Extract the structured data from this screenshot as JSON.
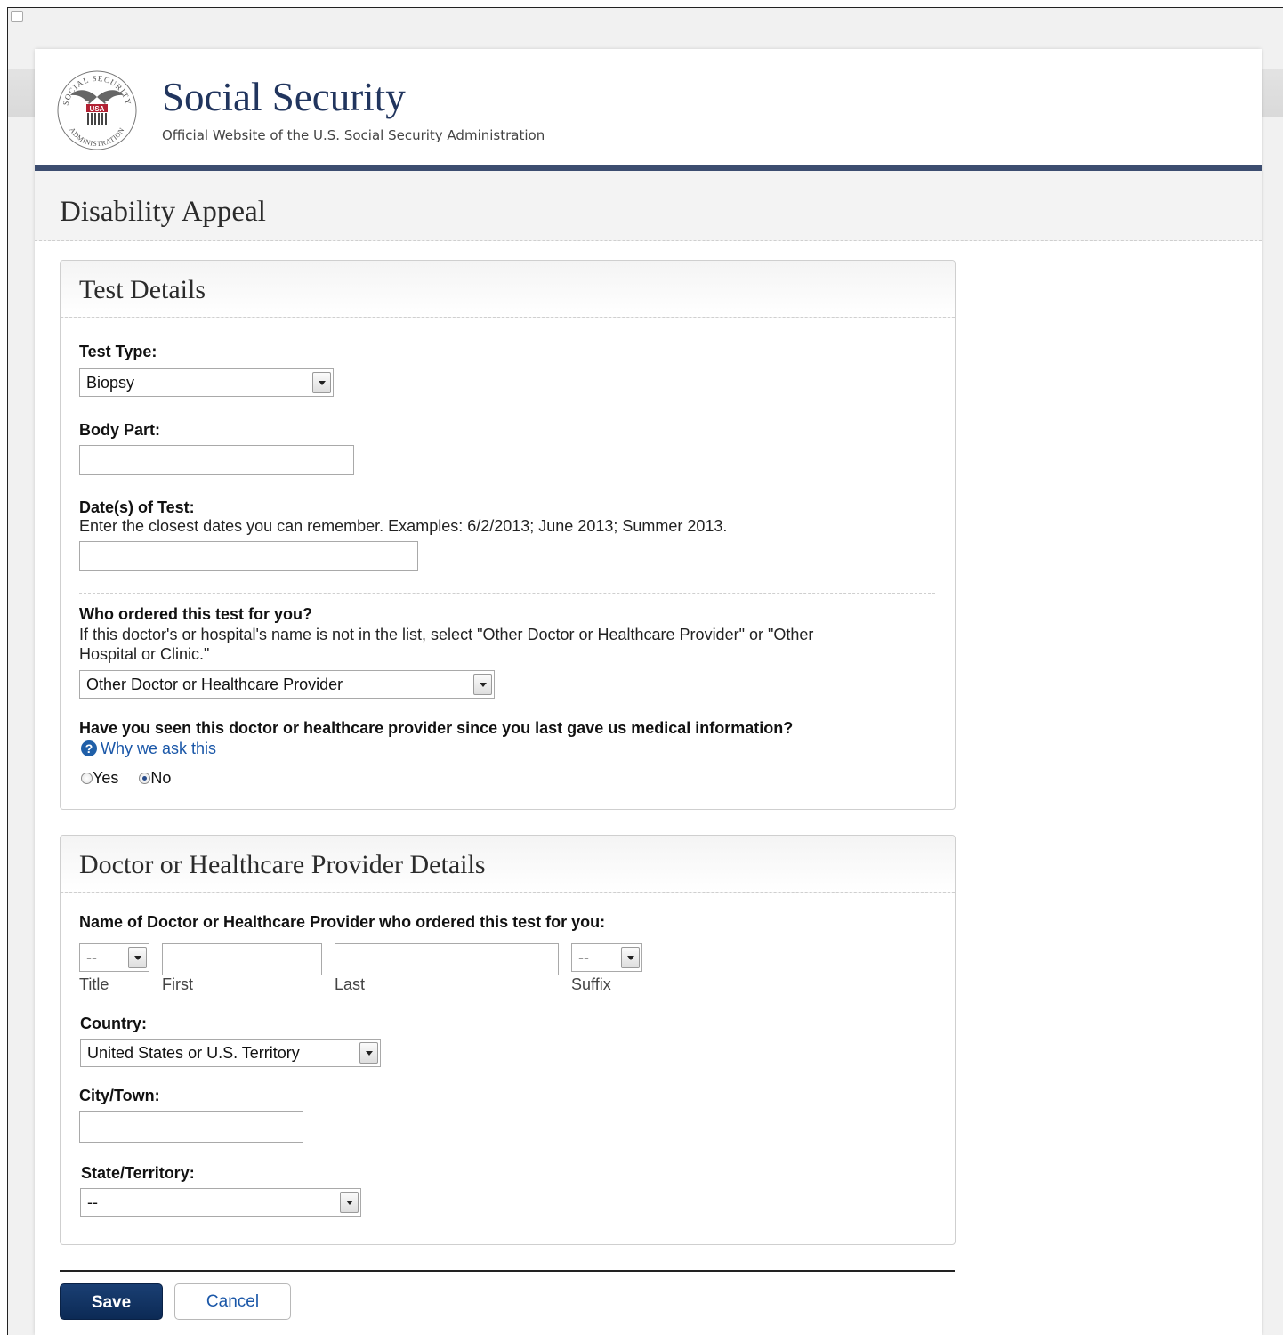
{
  "header": {
    "seal_text_top": "SOCIAL SECURITY",
    "seal_text_bottom": "ADMINISTRATION",
    "seal_center": "USA",
    "site_title": "Social Security",
    "site_subtitle": "Official Website of the U.S. Social Security Administration"
  },
  "page": {
    "title": "Disability Appeal"
  },
  "test_details": {
    "panel_title": "Test Details",
    "test_type": {
      "label": "Test Type:",
      "value": "Biopsy"
    },
    "body_part": {
      "label": "Body Part:",
      "value": ""
    },
    "dates": {
      "label": "Date(s) of Test:",
      "help": "Enter the closest dates you can remember. Examples: 6/2/2013; June 2013; Summer 2013.",
      "value": ""
    },
    "ordered_by": {
      "label": "Who ordered this test for you?",
      "help_line1": "If this doctor's or hospital's name is not in the list, select \"Other Doctor or Healthcare Provider\" or \"Other",
      "help_line2": "Hospital or Clinic.\"",
      "value": "Other Doctor or Healthcare Provider"
    },
    "seen_since": {
      "label": "Have you seen this doctor or healthcare provider since you last gave us medical information?",
      "why_link": "Why we ask this",
      "yes_label": "Yes",
      "no_label": "No",
      "selected": "No"
    }
  },
  "provider_details": {
    "panel_title": "Doctor or Healthcare Provider Details",
    "name_label": "Name of Doctor or Healthcare Provider who ordered this test for you:",
    "title": {
      "value": "--",
      "sublabel": "Title"
    },
    "first": {
      "value": "",
      "sublabel": "First"
    },
    "last": {
      "value": "",
      "sublabel": "Last"
    },
    "suffix": {
      "value": "--",
      "sublabel": "Suffix"
    },
    "country": {
      "label": "Country:",
      "value": "United States or U.S. Territory"
    },
    "city": {
      "label": "City/Town:",
      "value": ""
    },
    "state": {
      "label": "State/Territory:",
      "value": "--"
    }
  },
  "actions": {
    "save_label": "Save",
    "cancel_label": "Cancel"
  },
  "colors": {
    "brand_navy": "#21355e",
    "header_rule": "#3c4d70",
    "save_button": "#0c2a55",
    "link": "#1a57a8"
  }
}
